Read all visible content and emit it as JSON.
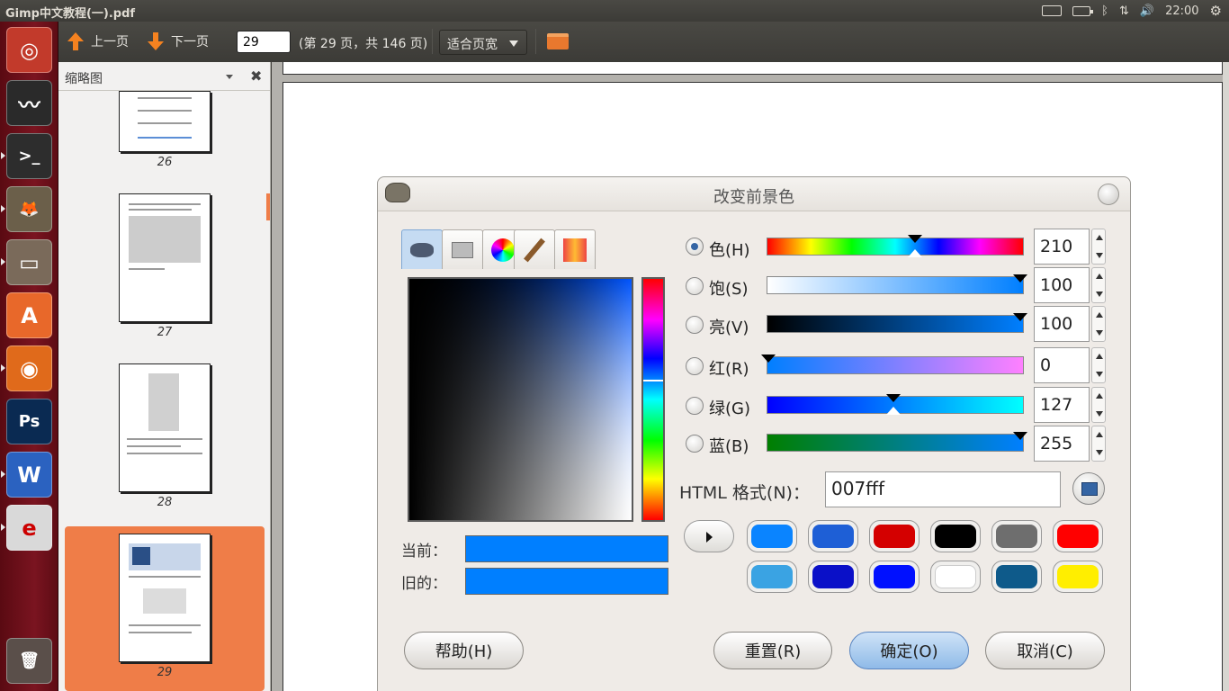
{
  "window": {
    "title": "Gimp中文教程(一).pdf"
  },
  "panel": {
    "clock": "22:00"
  },
  "launcher": {
    "items": [
      {
        "name": "ubuntu-dash-icon",
        "glyph": "◎",
        "bg": "#c23a2b"
      },
      {
        "name": "system-monitor-icon",
        "glyph": "〰",
        "bg": "#2a2a2a"
      },
      {
        "name": "terminal-icon",
        "glyph": ">_",
        "bg": "#2d2d2d"
      },
      {
        "name": "gimp-icon",
        "glyph": "🦊",
        "bg": "#6b5f4a"
      },
      {
        "name": "files-icon",
        "glyph": "▭",
        "bg": "#7a6a5a"
      },
      {
        "name": "software-center-icon",
        "glyph": "A",
        "bg": "#e8682a"
      },
      {
        "name": "firefox-icon",
        "glyph": "◉",
        "bg": "#e06a1b"
      },
      {
        "name": "photoshop-icon",
        "glyph": "Ps",
        "bg": "#0a2a52"
      },
      {
        "name": "wps-writer-icon",
        "glyph": "W",
        "bg": "#2b62c0"
      },
      {
        "name": "pdf-reader-icon",
        "glyph": "e",
        "bg": "#d9d9d9"
      },
      {
        "name": "trash-icon",
        "glyph": "🗑",
        "bg": "#5a4f4a"
      }
    ]
  },
  "toolbar": {
    "prev_label": "上一页",
    "next_label": "下一页",
    "page_value": "29",
    "page_info": "(第 29 页，共 146 页)",
    "zoom_label": "适合页宽"
  },
  "sidebar": {
    "title": "缩略图",
    "thumbnails": [
      {
        "page": "26"
      },
      {
        "page": "27"
      },
      {
        "page": "28"
      },
      {
        "page": "29"
      }
    ]
  },
  "dialog": {
    "title": "改变前景色",
    "current_label": "当前：",
    "old_label": "旧的：",
    "current_color": "#007fff",
    "old_color": "#007fff",
    "channels": [
      {
        "label": "色(H)",
        "value": "210",
        "selected": true
      },
      {
        "label": "饱(S)",
        "value": "100",
        "selected": false
      },
      {
        "label": "亮(V)",
        "value": "100",
        "selected": false
      },
      {
        "label": "红(R)",
        "value": "0",
        "selected": false
      },
      {
        "label": "绿(G)",
        "value": "127",
        "selected": false
      },
      {
        "label": "蓝(B)",
        "value": "255",
        "selected": false
      }
    ],
    "hex_label": "HTML 格式(N)：",
    "hex_value": "007fff",
    "history_colors": [
      "#0a84ff",
      "#1e5fd6",
      "#d40000",
      "#000000",
      "#6e6e6e",
      "#ff0000",
      "#3aa3e3",
      "#0a10c8",
      "#0010ff",
      "#ffffff",
      "#0e5a8a",
      "#ffee00"
    ],
    "buttons": {
      "help": "帮助(H)",
      "reset": "重置(R)",
      "ok": "确定(O)",
      "cancel": "取消(C)"
    }
  }
}
